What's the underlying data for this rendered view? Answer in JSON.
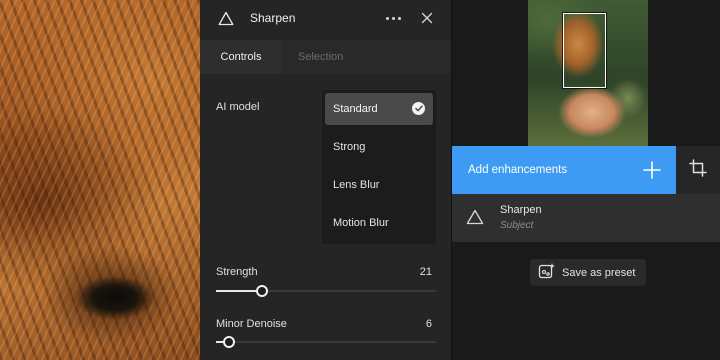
{
  "panel": {
    "title": "Sharpen",
    "tabs": [
      {
        "label": "Controls",
        "active": true
      },
      {
        "label": "Selection",
        "active": false
      }
    ],
    "ai_model": {
      "label": "AI model",
      "selected": "Standard",
      "options": [
        "Standard",
        "Strong",
        "Lens Blur",
        "Motion Blur"
      ]
    },
    "strength": {
      "label": "Strength",
      "value": "21",
      "fraction": 0.21
    },
    "minor_denoise": {
      "label": "Minor Denoise",
      "value": "6",
      "fraction": 0.06
    }
  },
  "right": {
    "add_enhancements_label": "Add enhancements",
    "layer": {
      "title": "Sharpen",
      "subtitle": "Subject"
    },
    "save_preset_label": "Save as preset"
  },
  "colors": {
    "accent": "#3d9bf4",
    "panel_bg": "#252525",
    "app_bg": "#1a1a1a",
    "layer_bg": "#2f2f2f"
  },
  "icons": {
    "panel": "triangle-icon",
    "more": "more-dots-icon",
    "close": "close-icon",
    "selected": "check-circle-icon",
    "add": "plus-icon",
    "crop": "crop-icon",
    "layer": "triangle-icon",
    "preset": "preset-sparkle-icon"
  }
}
